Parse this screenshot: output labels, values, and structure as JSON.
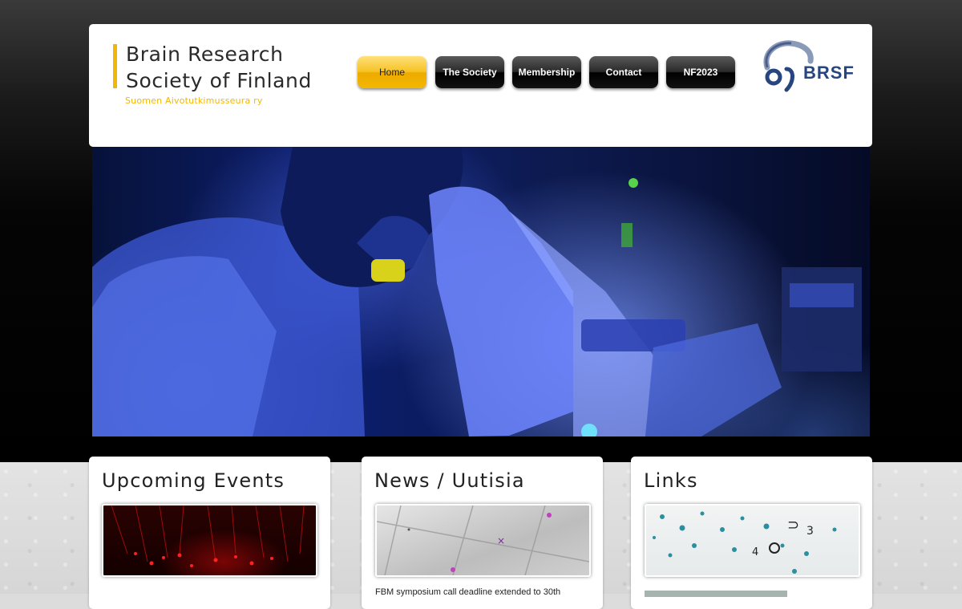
{
  "site": {
    "title_line1": "Brain Research",
    "title_line2": "Society of Finland",
    "subtitle": "Suomen Aivotutkimusseura ry",
    "logo_text": "BRSF"
  },
  "nav": {
    "items": [
      {
        "label": "Home",
        "active": true
      },
      {
        "label": "The Society",
        "active": false
      },
      {
        "label": "Membership",
        "active": false
      },
      {
        "label": "Contact",
        "active": false
      },
      {
        "label": "NF2023",
        "active": false
      }
    ]
  },
  "hero": {
    "image": "scientist-at-microscope-blue-light"
  },
  "cards": {
    "events": {
      "title": "Upcoming Events",
      "image": "red-neurons-microscopy"
    },
    "news": {
      "title": "News / Uutisia",
      "image": "microscope-slides",
      "first_item": "FBM symposium call deadline extended to 30th"
    },
    "links": {
      "title": "Links",
      "image": "stained-cell-culture-dish"
    }
  },
  "colors": {
    "accent": "#f2b705",
    "logo_blue": "#27467f",
    "nav_dark": "#000000"
  }
}
